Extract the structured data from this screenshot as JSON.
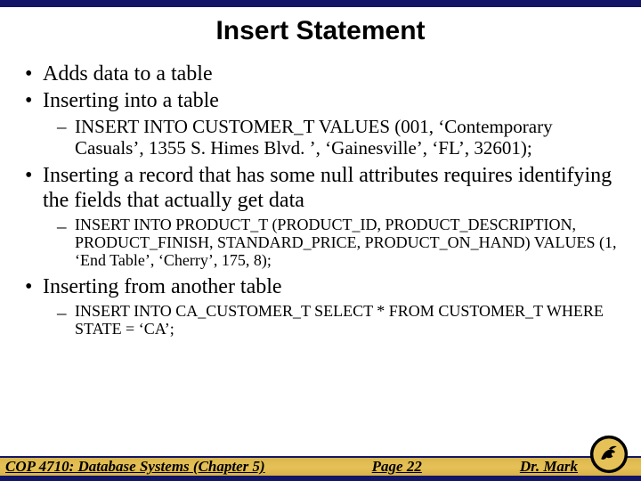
{
  "title": "Insert Statement",
  "bullets": {
    "b1": "Adds data to a table",
    "b2": "Inserting into a table",
    "b2_sub1": "INSERT INTO CUSTOMER_T VALUES (001, ‘Contemporary Casuals’, 1355 S. Himes Blvd. ’, ‘Gainesville’, ‘FL’, 32601);",
    "b3": "Inserting a record that has some null attributes requires identifying the fields that actually get data",
    "b3_sub1": "INSERT INTO PRODUCT_T (PRODUCT_ID, PRODUCT_DESCRIPTION, PRODUCT_FINISH, STANDARD_PRICE, PRODUCT_ON_HAND) VALUES (1, ‘End Table’, ‘Cherry’, 175, 8);",
    "b4": "Inserting from another table",
    "b4_sub1": "INSERT INTO CA_CUSTOMER_T SELECT * FROM CUSTOMER_T WHERE STATE = ‘CA’;"
  },
  "footer": {
    "course": "COP 4710: Database Systems  (Chapter 5)",
    "page": "Page 22",
    "author": "Dr. Mark"
  },
  "logo_name": "ucf-pegasus-logo"
}
